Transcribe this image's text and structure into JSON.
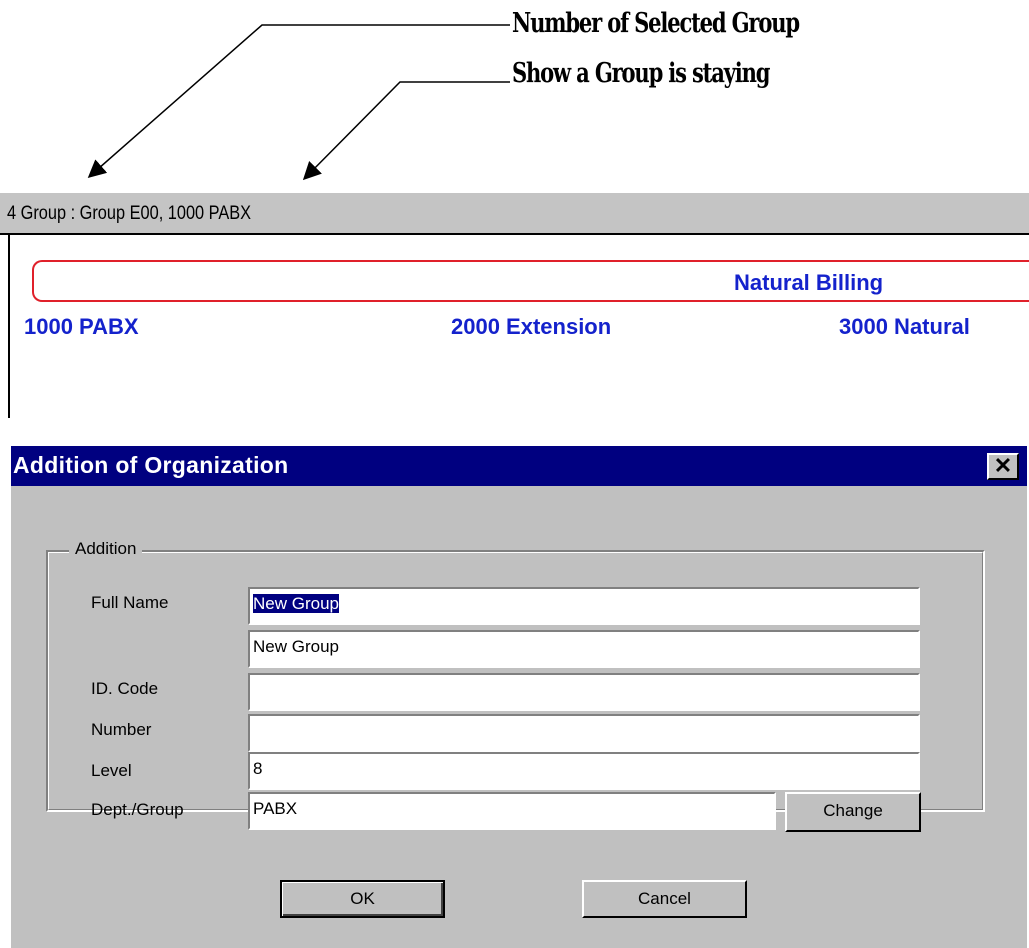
{
  "annotations": {
    "callout_1": "Number of Selected Group",
    "callout_2": "Show a Group is staying"
  },
  "group_panel": {
    "status_text": "4  Group  :  Group E00,  1000 PABX",
    "billing_label": "Natural Billing",
    "items": [
      {
        "label": "1000 PABX"
      },
      {
        "label": "2000 Extension"
      },
      {
        "label": "3000 Natural"
      }
    ]
  },
  "dialog": {
    "title": "Addition of Organization",
    "close_glyph": "✕",
    "group_title": "Addition",
    "fields": {
      "full_name": {
        "label": "Full Name",
        "value": "New Group"
      },
      "short_name": {
        "value": "New Group"
      },
      "id_code": {
        "label": "ID. Code",
        "value": ""
      },
      "number": {
        "label": "Number",
        "value": ""
      },
      "level": {
        "label": "Level",
        "value": "8"
      },
      "dept_group": {
        "label": "Dept./Group",
        "value": "PABX"
      }
    },
    "change_label": "Change",
    "ok_label": "OK",
    "cancel_label": "Cancel"
  },
  "colors": {
    "titlebar": "#000080",
    "dialog_face": "#c0c0c0",
    "link_blue": "#1422cc",
    "band_red": "#e0202a"
  }
}
